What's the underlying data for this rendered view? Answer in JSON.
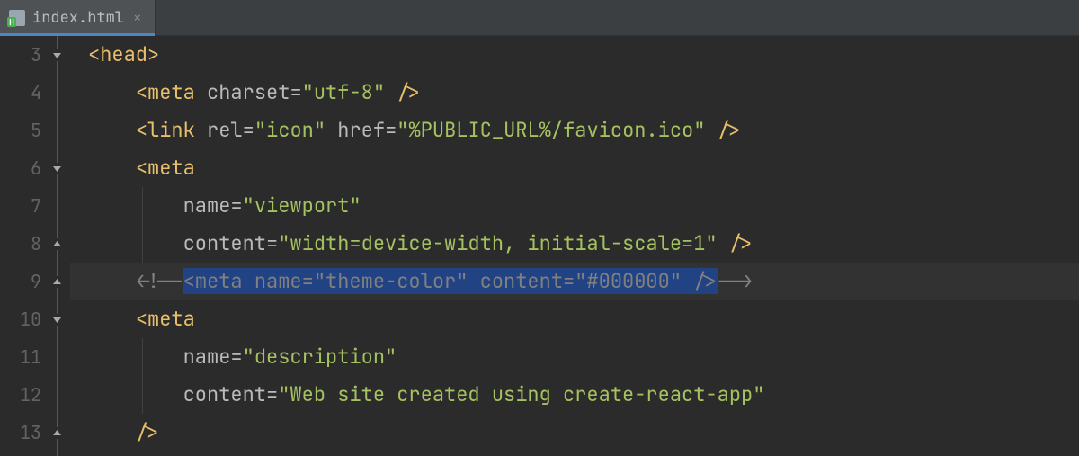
{
  "tab": {
    "filename": "index.html",
    "close_glyph": "×"
  },
  "gutter": {
    "start": 3,
    "end": 13
  },
  "tokens": {
    "lines": [
      {
        "n": 3,
        "indent": 0,
        "segs": [
          {
            "t": "<",
            "c": "punct"
          },
          {
            "t": "head",
            "c": "tag"
          },
          {
            "t": ">",
            "c": "punct"
          }
        ]
      },
      {
        "n": 4,
        "indent": 1,
        "segs": [
          {
            "t": "<",
            "c": "punct"
          },
          {
            "t": "meta ",
            "c": "tag"
          },
          {
            "t": "charset",
            "c": "attr"
          },
          {
            "t": "=",
            "c": "attr"
          },
          {
            "t": "\"utf-8\"",
            "c": "val"
          },
          {
            "t": " />",
            "c": "punct"
          }
        ]
      },
      {
        "n": 5,
        "indent": 1,
        "segs": [
          {
            "t": "<",
            "c": "punct"
          },
          {
            "t": "link ",
            "c": "tag"
          },
          {
            "t": "rel",
            "c": "attr"
          },
          {
            "t": "=",
            "c": "attr"
          },
          {
            "t": "\"icon\"",
            "c": "val"
          },
          {
            "t": " ",
            "c": "attr"
          },
          {
            "t": "href",
            "c": "attr"
          },
          {
            "t": "=",
            "c": "attr"
          },
          {
            "t": "\"%PUBLIC_URL%/favicon.ico\"",
            "c": "val"
          },
          {
            "t": " />",
            "c": "punct"
          }
        ]
      },
      {
        "n": 6,
        "indent": 1,
        "segs": [
          {
            "t": "<",
            "c": "punct"
          },
          {
            "t": "meta",
            "c": "tag"
          }
        ]
      },
      {
        "n": 7,
        "indent": 2,
        "segs": [
          {
            "t": "name",
            "c": "attr"
          },
          {
            "t": "=",
            "c": "attr"
          },
          {
            "t": "\"viewport\"",
            "c": "val"
          }
        ]
      },
      {
        "n": 8,
        "indent": 2,
        "segs": [
          {
            "t": "content",
            "c": "attr"
          },
          {
            "t": "=",
            "c": "attr"
          },
          {
            "t": "\"width=device-width, initial-scale=1\"",
            "c": "val"
          },
          {
            "t": " />",
            "c": "punct"
          }
        ]
      },
      {
        "n": 9,
        "indent": 1,
        "highlight": true,
        "segs": [
          {
            "t": "<!--",
            "c": "comment"
          },
          {
            "t": "<meta name=\"theme-color\" content=\"#000000\" />",
            "c": "comment",
            "sel": true
          },
          {
            "t": "-->",
            "c": "comment"
          }
        ]
      },
      {
        "n": 10,
        "indent": 1,
        "segs": [
          {
            "t": "<",
            "c": "punct"
          },
          {
            "t": "meta",
            "c": "tag"
          }
        ]
      },
      {
        "n": 11,
        "indent": 2,
        "segs": [
          {
            "t": "name",
            "c": "attr"
          },
          {
            "t": "=",
            "c": "attr"
          },
          {
            "t": "\"description\"",
            "c": "val"
          }
        ]
      },
      {
        "n": 12,
        "indent": 2,
        "segs": [
          {
            "t": "content",
            "c": "attr"
          },
          {
            "t": "=",
            "c": "attr"
          },
          {
            "t": "\"Web site created using create-react-app\"",
            "c": "val"
          }
        ]
      },
      {
        "n": 13,
        "indent": 1,
        "segs": [
          {
            "t": "/>",
            "c": "punct"
          }
        ]
      }
    ]
  },
  "fold_handles": [
    3,
    6,
    8,
    9,
    10,
    13
  ],
  "fold_down": [
    3,
    6,
    10
  ]
}
